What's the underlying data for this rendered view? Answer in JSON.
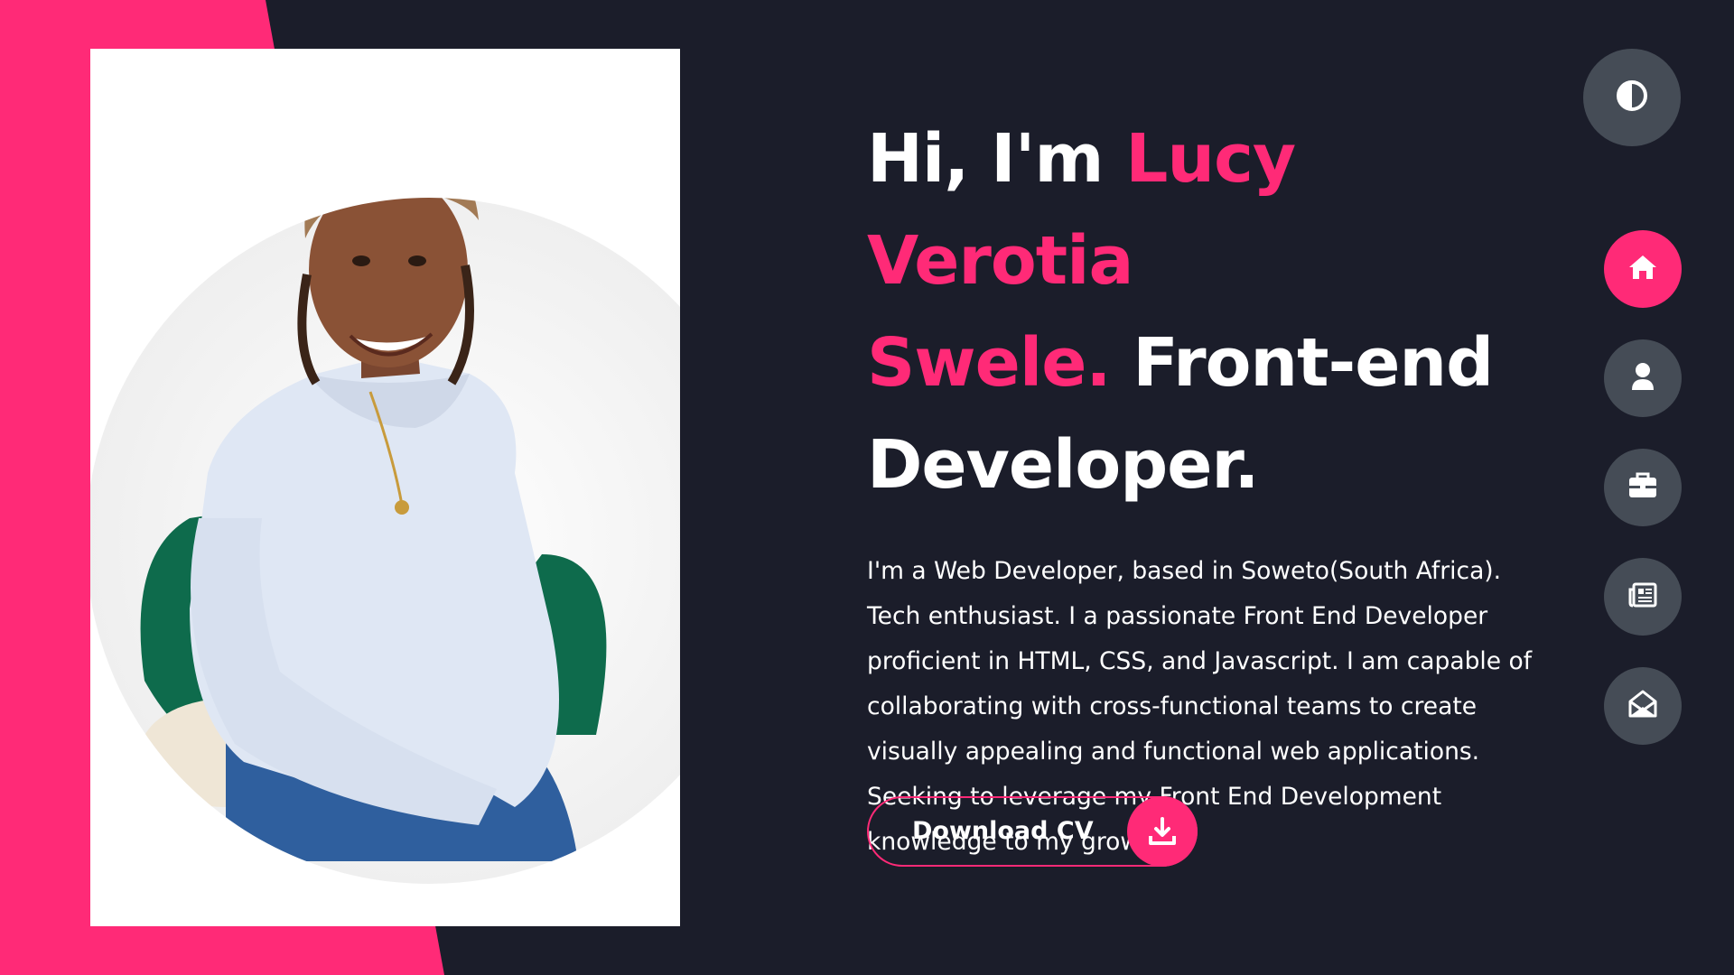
{
  "hero": {
    "greeting": "Hi, I'm ",
    "name_line1": "Lucy Verotia",
    "name_line2": "Swele.",
    "role_line2": " Front-end",
    "role_line3": "Developer.",
    "description": "I'm a Web Developer, based in Soweto(South Africa). Tech enthusiast. I a passionate Front End Developer proficient in HTML, CSS, and Javascript. I am capable of collaborating with cross-functional teams to create visually appealing and functional web applications. Seeking to leverage my Front End Development knowledge to my growth."
  },
  "cv_button": {
    "label": "Download CV",
    "icon": "download-icon"
  },
  "theme_toggle": {
    "icon": "contrast-icon"
  },
  "nav": {
    "items": [
      {
        "icon": "home-icon",
        "active": true
      },
      {
        "icon": "user-icon",
        "active": false
      },
      {
        "icon": "briefcase-icon",
        "active": false
      },
      {
        "icon": "newspaper-icon",
        "active": false
      },
      {
        "icon": "envelope-open-icon",
        "active": false
      }
    ]
  },
  "colors": {
    "background": "#1b1d2a",
    "accent": "#ff2a77",
    "button_grey": "#454c56",
    "text": "#ffffff"
  }
}
